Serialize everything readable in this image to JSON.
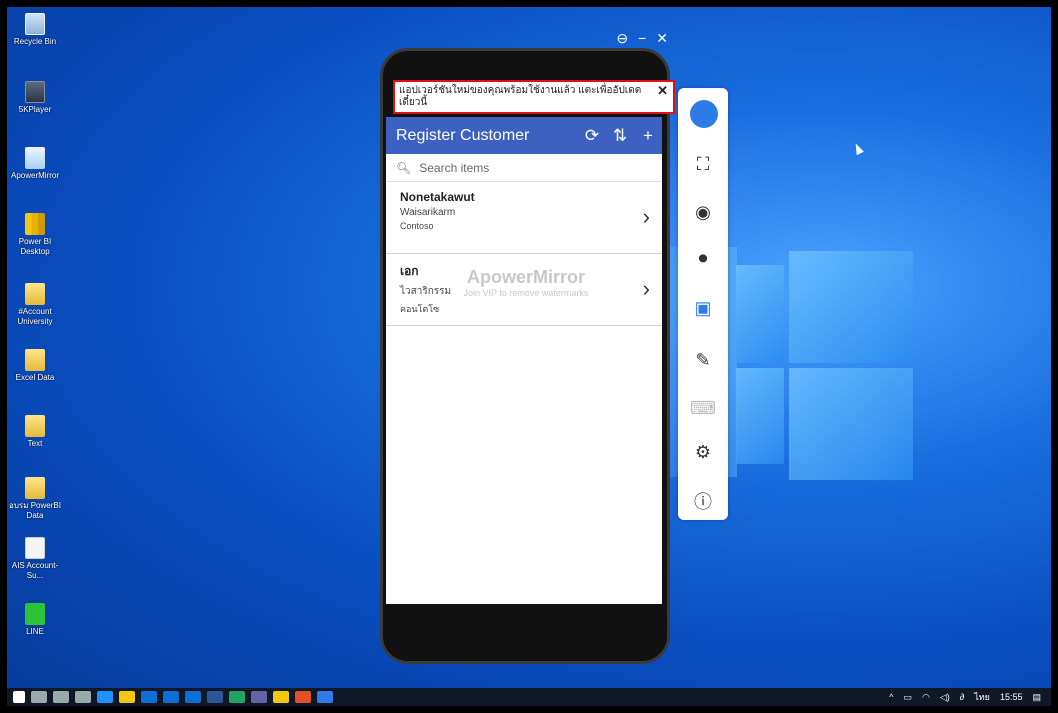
{
  "desktop": {
    "icons": [
      {
        "label": "Recycle Bin"
      },
      {
        "label": "5KPlayer"
      },
      {
        "label": "ApowerMirror"
      },
      {
        "label": "Power BI Desktop"
      },
      {
        "label": "#Account University"
      },
      {
        "label": "Excel Data"
      },
      {
        "label": "Text"
      },
      {
        "label": "อบรม PowerBI Data"
      },
      {
        "label": "AIS Account-Su..."
      },
      {
        "label": "LINE"
      }
    ]
  },
  "notification": {
    "text": "แอปเวอร์ชันใหม่ของคุณพร้อมใช้งานแล้ว แตะเพื่ออัปเดตเดี๋ยวนี้",
    "close": "✕"
  },
  "app": {
    "title": "Register Customer",
    "search_placeholder": "Search items",
    "items": [
      {
        "name": "Nonetakawut",
        "surname": "Waisarikarm",
        "company": "Contoso"
      },
      {
        "name": "เอก",
        "surname": "ไวสาริกรรม",
        "company": "คอนโตโซ"
      }
    ]
  },
  "watermark": {
    "brand": "ApowerMirror",
    "note": "Join VIP to remove watermarks"
  },
  "taskbar": {
    "language": "ไทย",
    "time": "15:55"
  },
  "colors": {
    "app_header": "#3c61c0",
    "highlight_border": "#e01010",
    "accent": "#2d7ce8"
  }
}
